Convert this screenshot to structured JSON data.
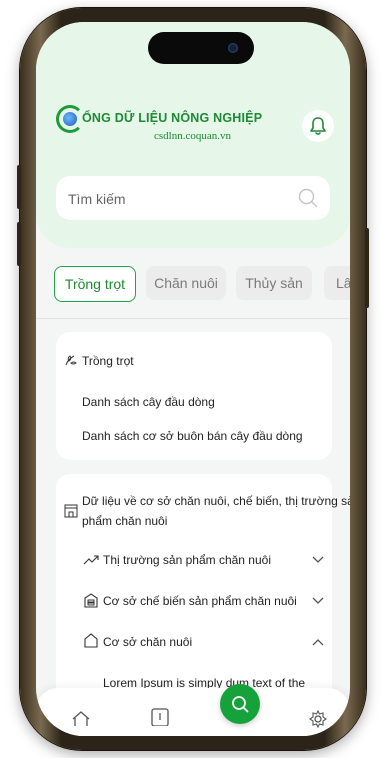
{
  "brand": {
    "title": "ỔNG DỮ LIỆU NÔNG NGHIỆP",
    "subtitle": "csdlnn.coquan.vn"
  },
  "search": {
    "placeholder": "Tìm kiếm"
  },
  "tabs": [
    {
      "label": "Trồng trọt",
      "active": true
    },
    {
      "label": "Chăn nuôi",
      "active": false
    },
    {
      "label": "Thủy sản",
      "active": false
    },
    {
      "label": "Lâm",
      "active": false
    }
  ],
  "crop_card": {
    "heading": "Trồng trọt",
    "items": [
      "Danh sách cây đầu dòng",
      "Danh sách cơ sở buôn bán cây đầu dòng"
    ]
  },
  "livestock_card": {
    "heading_line1": "Dữ liệu về cơ sở chăn nuôi, chế biến, thị trường sản",
    "heading_line2": "phẩm chăn nuôi",
    "sections": [
      {
        "label": "Thị trường sản phẩm chăn nuôi",
        "icon": "trending-up-icon",
        "expanded": false
      },
      {
        "label": "Cơ sở chế biến sản phẩm chăn nuôi",
        "icon": "factory-icon",
        "expanded": false
      },
      {
        "label": "Cơ sở chăn nuôi",
        "icon": "home-icon",
        "expanded": true
      }
    ],
    "expanded_text": "Lorem Ipsum is simply dum   text of the"
  },
  "colors": {
    "accent": "#16a23a",
    "header_bg": "#e6f7ea",
    "brand_text": "#1d8a34"
  }
}
